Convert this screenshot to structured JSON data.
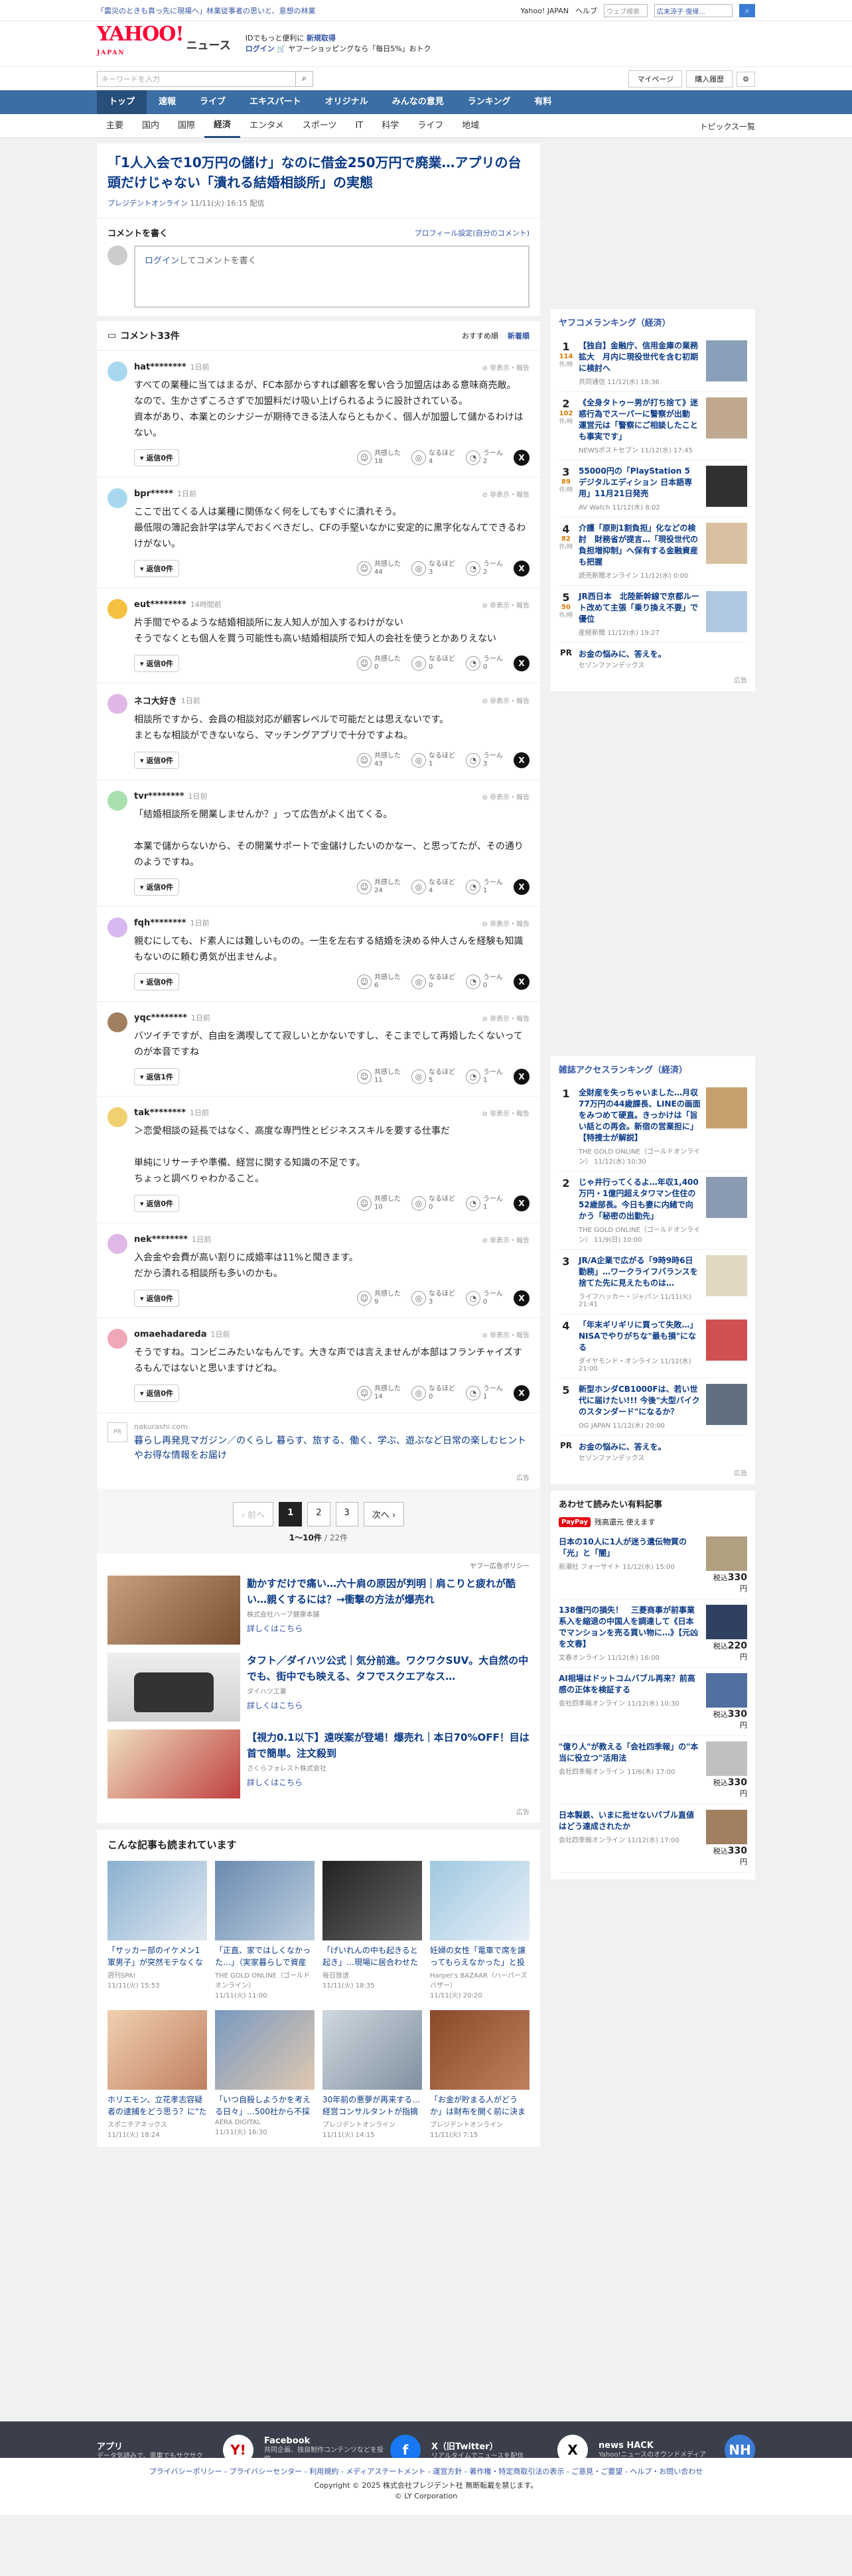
{
  "topbar": {
    "left": "「震災のときも真っ先に現場へ」林業従事者の思いと、意想の林業",
    "yj": "Yahoo! JAPAN",
    "help": "ヘルプ",
    "search_ph": "ウェブ検索",
    "user": "広末涼子 復帰...",
    "search_btn": "検索"
  },
  "header": {
    "logo": "YAHOO!",
    "logo_sub": "JAPAN",
    "news": "ニュース",
    "promo1a": "IDでもっと便利に",
    "promo1b": "新規取得",
    "promo2a": "ログイン",
    "promo2b": "ヤフーショッピングなら「毎日5%」おトク"
  },
  "search": {
    "ph": "キーワードを入力",
    "mypage": "マイページ",
    "history": "購入履歴"
  },
  "gnav": [
    "トップ",
    "速報",
    "ライブ",
    "エキスパート",
    "オリジナル",
    "みんなの意見",
    "ランキング",
    "有料"
  ],
  "snav": [
    "主要",
    "国内",
    "国際",
    "経済",
    "エンタメ",
    "スポーツ",
    "IT",
    "科学",
    "ライフ",
    "地域"
  ],
  "snav_topics": "トピックス一覧",
  "article": {
    "title": "「1人入会で10万円の儲け」なのに借金250万円で廃業…アプリの台頭だけじゃない「潰れる結婚相談所」の実態",
    "source": "プレジデントオンライン",
    "date": "11/11(火) 16:15 配信"
  },
  "cwrite": {
    "title": "コメントを書く",
    "profile": "プロフィール設定(自分のコメント)",
    "login": "ログイン",
    "rest": "してコメントを書く"
  },
  "clist": {
    "title": "コメント33件",
    "sort1": "おすすめ順",
    "sort2": "新着順"
  },
  "labels": {
    "hide": "非表示・報告",
    "replies": "返信0件",
    "r1": "共感した",
    "r2": "なるほど",
    "r3": "うーん"
  },
  "comments": [
    {
      "user": "hat********",
      "date": "1日前",
      "text": "すべての業種に当てはまるが、FC本部からすれば顧客を奪い合う加盟店はある意味商売敵。\nなので、生かさずころさずで加盟料だけ吸い上げられるように設計されている。\n資本があり、本業とのシナジーが期待できる法人ならともかく、個人が加盟して儲かるわけはない。",
      "reply": "返信0件",
      "a": "18",
      "b": "4",
      "c": "2"
    },
    {
      "user": "bpr*****",
      "date": "1日前",
      "text": "ここで出てくる人は業種に関係なく何をしてもすぐに潰れそう。\n最低限の簿記会計学は学んでおくべきだし、CFの手堅いなかに安定的に黒字化なんてできるわけがない。",
      "reply": "返信0件",
      "a": "44",
      "b": "3",
      "c": "2"
    },
    {
      "user": "eut********",
      "date": "14時間前",
      "text": "片手間でやるような結婚相談所に友人知人が加入するわけがない\nそうでなくとも個人を買う可能性も高い結婚相談所で知人の会社を使うとかありえない",
      "reply": "返信0件",
      "a": "0",
      "b": "0",
      "c": "0"
    },
    {
      "user": "ネコ大好き",
      "date": "1日前",
      "text": "相談所ですから、会員の相談対応が顧客レベルで可能だとは思えないです。\nまともな相談ができないなら、マッチングアプリで十分ですよね。",
      "reply": "返信0件",
      "a": "43",
      "b": "1",
      "c": "3"
    },
    {
      "user": "tvr********",
      "date": "1日前",
      "text": "「結婚相談所を開業しませんか？」って広告がよく出てくる。\n\n本業で儲からないから、その開業サポートで金儲けしたいのかなー、と思ってたが、その通りのようですね。",
      "reply": "返信0件",
      "a": "24",
      "b": "4",
      "c": "1"
    },
    {
      "user": "fqh********",
      "date": "1日前",
      "text": "親むにしても、ド素人には難しいものの。一生を左右する結婚を決める仲人さんを経験も知識もないのに頼む勇気が出ませんよ。",
      "reply": "返信0件",
      "a": "6",
      "b": "0",
      "c": "0"
    },
    {
      "user": "yqc********",
      "date": "1日前",
      "text": "バツイチですが、自由を満喫してて寂しいとかないですし、そこまでして再婚したくないってのが本音ですね",
      "reply": "返信1件",
      "a": "11",
      "b": "5",
      "c": "1"
    },
    {
      "user": "tak********",
      "date": "1日前",
      "text": "＞恋愛相談の延長ではなく、高度な専門性とビジネススキルを要する仕事だ\n\n単純にリサーチや準備、経営に関する知識の不足です。\nちょっと調べりゃわかること。",
      "reply": "返信0件",
      "a": "10",
      "b": "0",
      "c": "1"
    },
    {
      "user": "nek********",
      "date": "1日前",
      "text": "入会金や会費が高い割りに成婚率は11%と聞きます。\nだから潰れる相談所も多いのかも。",
      "reply": "返信0件",
      "a": "9",
      "b": "3",
      "c": "0"
    },
    {
      "user": "omaehadareda",
      "date": "1日前",
      "text": "そうですね。コンビニみたいなもんです。大きな声では言えませんが本部はフランチャイズするもんではないと思いますけどね。",
      "reply": "返信0件",
      "a": "14",
      "b": "0",
      "c": "1"
    }
  ],
  "adlink": {
    "icon": "PR",
    "site": "nakurashi.com",
    "text": "暮らし再発見マガジン／のくらし 暮らす、旅する、働く、学ぶ、遊ぶなど日常の楽しむヒントやお得な情報をお届け",
    "mark": "広告"
  },
  "pager": {
    "prev": "前へ",
    "p1": "1",
    "p2": "2",
    "p3": "3",
    "next": "次へ",
    "count": "1〜10件",
    "total": "/ 22件"
  },
  "ads": {
    "policy": "ヤフー広告ポリシー",
    "mark": "広告",
    "items": [
      {
        "h": "勤かすだけで痛い…六十肩の原因が判明｜肩こりと疲れが酷い…親くするには？→衝撃の方法が爆売れ",
        "s": "株式会社ハーブ健康本舗",
        "m": "詳しくはこちら"
      },
      {
        "h": "タフト／ダイハツ公式｜気分前進。ワクワクSUV。大自然の中でも、街中でも映える、タフでスクエアなス…",
        "s": "ダイハツ工業",
        "m": "詳しくはこちら"
      },
      {
        "h": "【視力0.1以下】遠咲案が登場！爆売れ｜本日70%OFF！目は首で簡単。注文殺到",
        "s": "さくらフォレスト株式会社",
        "m": "詳しくはこちら"
      }
    ]
  },
  "reads": {
    "title": "こんな記事も読まれています",
    "items": [
      {
        "t": "「サッカー部のイケメン1軍男子」が突然モテなくなったワケ、「…",
        "s": "週刊SPA!",
        "d": "11/11(火) 15:53"
      },
      {
        "t": "「正直、家ではしくなかった…」（実家暮らしで資産4,000万円送…",
        "s": "THE GOLD ONLINE（ゴールドオンライン）",
        "d": "11/11(火) 11:00"
      },
      {
        "t": "「げいれんの中も起きると起き」…現場に居合わせた友人が証言…",
        "s": "毎日放送",
        "d": "11/11(火) 18:35"
      },
      {
        "t": "妊婦の女性「電車で席を譲ってもらえなかった」と投稿し、批判…",
        "s": "Harper's BAZAAR（ハーパーズ バザー）",
        "d": "11/11(火) 20:20"
      },
      {
        "t": "ホリエモン、立花孝志容疑者の逮捕をどう思う？に\"たった一言\"…",
        "s": "スポニチアネックス",
        "d": "11/11(火) 18:24"
      },
      {
        "t": "「いつ自殺しようかを考える日々」…500社から不採用となり人…",
        "s": "AERA DIGITAL",
        "d": "11/11(火) 16:30"
      },
      {
        "t": "30年前の悪夢が再来する…経営コンサルタントが指摘する「サナ…",
        "s": "プレジデントオンライン",
        "d": "11/11(火) 14:15"
      },
      {
        "t": "「お金が貯まる人がどうか」は財布を開く前に決まっている…お…",
        "s": "プレジデントオンライン",
        "d": "11/11(火) 7:15"
      }
    ]
  },
  "side_rank": {
    "title": "ヤフコメランキング（経済）",
    "items": [
      {
        "n": "1",
        "c": "114",
        "cl": "件/時",
        "t": "【独自】金融庁、信用金庫の業務拡大　月内に現役世代を含む初期に検討へ",
        "s": "共同通信 11/12(水) 18:36"
      },
      {
        "n": "2",
        "c": "102",
        "cl": "件/時",
        "t": "《全身タトゥー男が打ち捨て》迷惑行為でスーパーに警察が出動　運営元は「警察にご相談したことも事実です」",
        "s": "NEWSポストセブン 11/12(水) 17:45"
      },
      {
        "n": "3",
        "c": "89",
        "cl": "件/時",
        "t": "55000円の「PlayStation 5 デジタルエディション 日本語専用」11月21日発売",
        "s": "AV Watch 11/12(水) 8:02"
      },
      {
        "n": "4",
        "c": "82",
        "cl": "件/時",
        "t": "介護「原則1割負担」化などの検討　財務省が提言…「現役世代の負担増抑制」へ保有する金融資産も把握",
        "s": "読売新聞オンライン 11/12(水) 0:00"
      },
      {
        "n": "5",
        "c": "50",
        "cl": "件/時",
        "t": "JR西日本　北陸新幹線で京都ルート改めて主張「乗り換え不要」で優位",
        "s": "産経新聞 11/12(水) 19:27"
      }
    ],
    "pr": {
      "lb": "PR",
      "t": "お金の悩みに、答えを。",
      "s": "セゾンファンデックス"
    },
    "mark": "広告"
  },
  "side_mag": {
    "title": "雑誌アクセスランキング（経済）",
    "items": [
      {
        "n": "1",
        "t": "全財産を失っちゃいました…月収77万円の44歳課長、LINEの画面をみつめて硬直。きっかけは「旨い話との再会。新宿の営業担に」【特捜士が解説】",
        "s": "THE GOLD ONLINE（ゴールドオンライン） 11/12(水) 10:30"
      },
      {
        "n": "2",
        "t": "じゃ井行ってくるよ…年収1,400万円・1億円超えタワマン住住の52歳部長。今日も妻に内緒で向かう「秘密の出勤先」",
        "s": "THE GOLD ONLINE（ゴールドオンライン） 11/9(日) 10:00"
      },
      {
        "n": "3",
        "t": "JR/A企業で広がる「9時9時6日勤務」…ワークライフバランスを捨てた先に見えたものは…",
        "s": "ライフハッカー・ジャパン 11/11(火) 21:41"
      },
      {
        "n": "4",
        "t": "「年末ギリギリに買って失敗…」NISAでやりがちな\"最も損\"になる",
        "s": "ダイヤモンド・オンライン 11/12(水) 21:00"
      },
      {
        "n": "5",
        "t": "新型ホンダCB1000Fは、若い世代に届けたい!!! 今後\"大型バイクのスタンダード\"になるか？",
        "s": "OG JAPAN 11/12(水) 20:00"
      }
    ],
    "pr": {
      "lb": "PR",
      "t": "お金の悩みに、答えを。",
      "s": "セゾンファンデックス"
    },
    "mark": "広告"
  },
  "side_paid": {
    "title": "あわせて読みたい有料記事",
    "pp": "PayPay",
    "pp_rest": "残高還元 使えます",
    "items": [
      {
        "t": "日本の10人に1人が迷う遺伝物質の「光」と「闇」",
        "s": "新潮社 フォーサイト 11/12(水) 15:00",
        "p": "330"
      },
      {
        "t": "138億円の損失！　三菱商事が前事業系入を縮退の中国人を調達して《日本でマンションを売る買い物に…》【元凶を文春】",
        "s": "文春オンライン 11/12(水) 16:00",
        "p": "220"
      },
      {
        "t": "AI相場はドットコムバブル再来？前高感の正体を検証する",
        "s": "会社四季報オンライン 11/12(水) 10:30",
        "p": "330"
      },
      {
        "t": "\"億り人\"が教える「会社四季報」の\"本当に役立つ\"活用法",
        "s": "会社四季報オンライン 11/6(木) 17:00",
        "p": "330"
      },
      {
        "t": "日本製鉄、いまに批せないバブル直値はどう達成されたか",
        "s": "会社四季報オンライン 11/12(水) 17:00",
        "p": "330"
      }
    ],
    "yen": "円",
    "tax": "税込"
  },
  "footer": {
    "apps": [
      {
        "t": "アプリ",
        "s": "データ気読みで、電車でもサクサク",
        "ic": "Y!"
      },
      {
        "t": "Facebook",
        "s": "共同企画、独自制作コンテンツなどを投稿",
        "ic": "f"
      },
      {
        "t": "X（旧Twitter）",
        "s": "リアルタイムでニュースを配信",
        "ic": "X"
      },
      {
        "t": "news HACK",
        "s": "Yahoo!ニュースのオウンドメディア",
        "ic": "NH"
      }
    ],
    "links": [
      "トップ",
      "速報",
      "ライブ",
      "エキスパート",
      "オリジナル",
      "みんなの意見",
      "ランキング",
      "有料",
      "RSS",
      "ニュース提供社"
    ],
    "bottom": "プライバシーポリシー - プライバシーセンター - 利用規約 - メディアステートメント - 運営方針 - 著作権・特定商取引法の表示 - ご意見・ご要望 - ヘルプ・お問い合わせ",
    "copy1": "Copyright © 2025 株式会社プレジデント社 無断転載を禁じます。",
    "copy2": "© LY Corporation"
  }
}
